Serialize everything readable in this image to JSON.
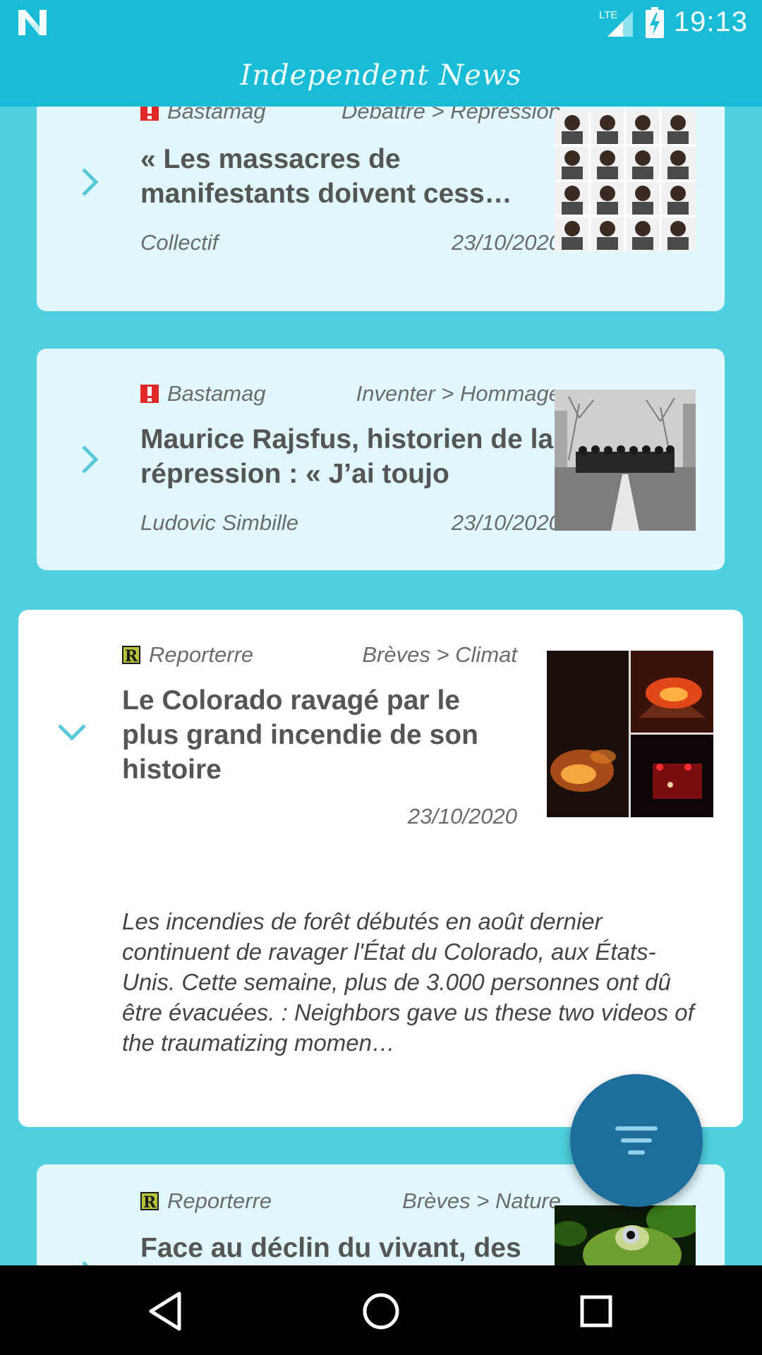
{
  "status_bar": {
    "time": "19:13",
    "network_label": "LTE",
    "icons": [
      "android-n-icon",
      "signal-icon",
      "battery-charging-icon"
    ]
  },
  "app": {
    "title": "Independent News"
  },
  "articles": [
    {
      "source": "Bastamag",
      "source_icon": "bastamag-logo-icon",
      "category": "Débattre > Répression",
      "title": "« Les massacres de manifestants doivent cess…",
      "author": "Collectif",
      "date": "23/10/2020",
      "expanded": false
    },
    {
      "source": "Bastamag",
      "source_icon": "bastamag-logo-icon",
      "category": "Inventer > Hommage",
      "title": "Maurice Rajsfus, historien de la répression : « J’ai toujo",
      "author": "Ludovic Simbille",
      "date": "23/10/2020",
      "expanded": false
    },
    {
      "source": "Reporterre",
      "source_icon": "reporterre-logo-icon",
      "category": "Brèves > Climat",
      "title": "Le Colorado ravagé par le plus grand incendie de son histoire",
      "author": "",
      "date": "23/10/2020",
      "summary": "Les incendies de forêt débutés en août dernier continuent de ravager l'État du Colorado, aux États-Unis. Cette semaine, plus de 3.000 personnes ont dû être évacuées. : Neighbors gave us these two videos of the traumatizing momen…",
      "expanded": true
    },
    {
      "source": "Reporterre",
      "source_icon": "reporterre-logo-icon",
      "category": "Brèves > Nature",
      "title": "Face au déclin du vivant, des",
      "author": "",
      "date": "",
      "expanded": false
    }
  ],
  "fab": {
    "icon": "filter-icon"
  },
  "nav_bar": {
    "icons": [
      "back-icon",
      "home-icon",
      "recents-icon"
    ]
  },
  "colors": {
    "status_bar": "#19bcd6",
    "background": "#4fd0e0",
    "card": "#e0f8fc",
    "card_expanded": "#ffffff",
    "fab": "#1e6e9c",
    "chevron": "#5ac8d8"
  }
}
